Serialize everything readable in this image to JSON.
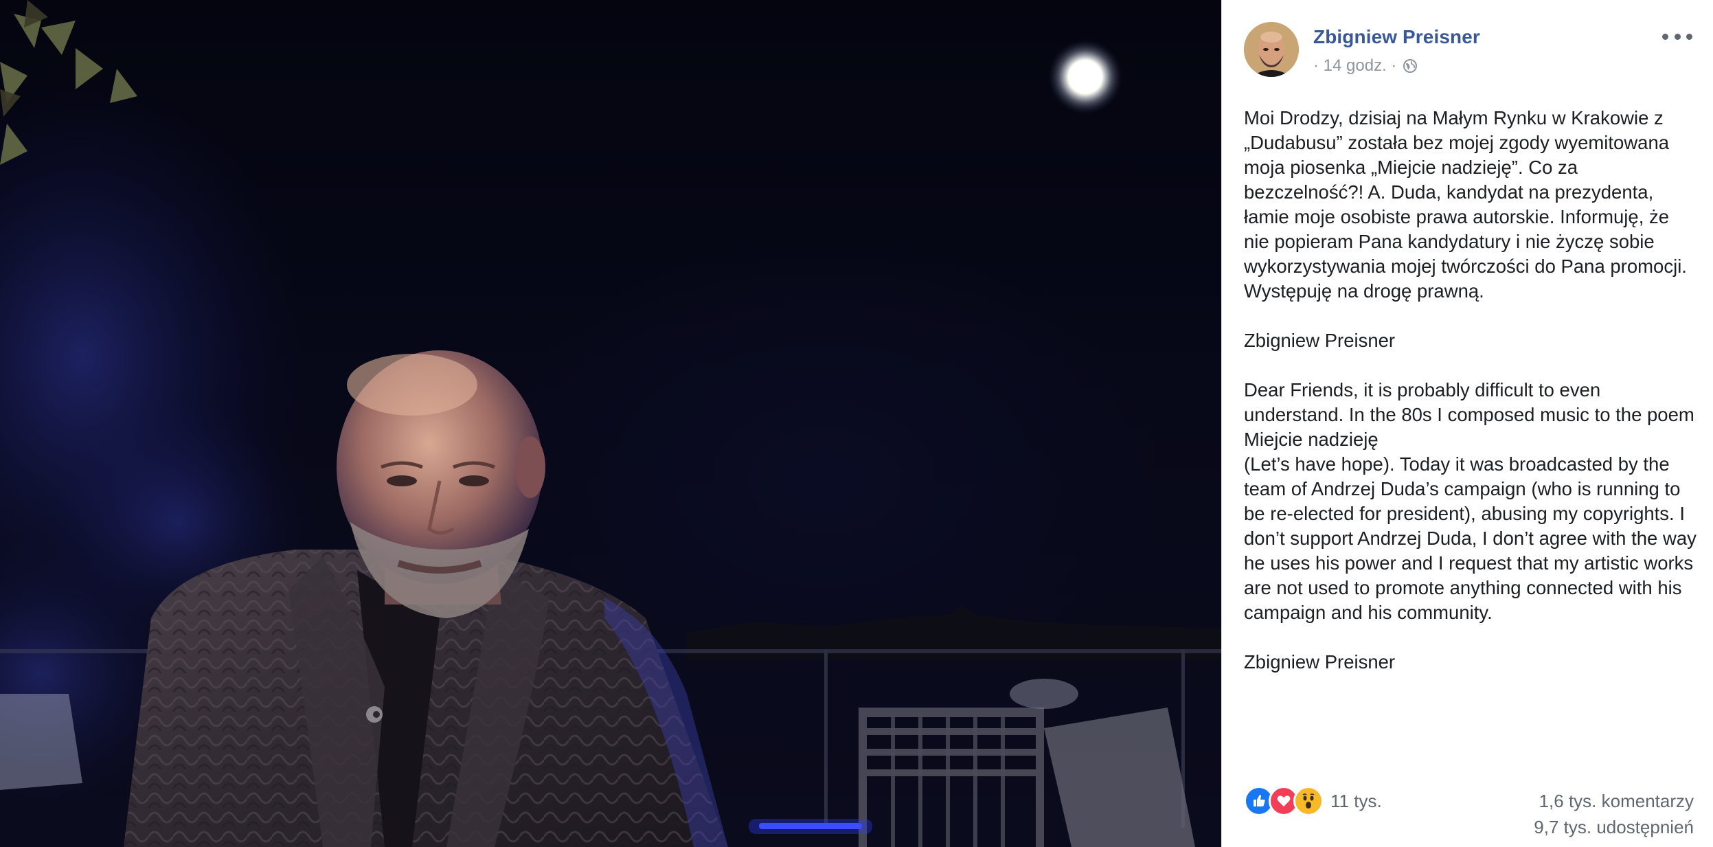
{
  "post": {
    "author": "Zbigniew Preisner",
    "timestamp": "· 14 godz. ·",
    "privacy_icon": "globe-icon",
    "more_icon": "more-options-icon",
    "paragraphs": [
      "Moi Drodzy, dzisiaj na Małym Rynku w Krakowie z „Dudabusu” została bez mojej zgody wyemitowana moja piosenka „Miejcie nadzieję”. Co za bezczelność?! A. Duda, kandydat na prezydenta, łamie moje osobiste prawa autorskie. Informuję, że nie popieram Pana kandydatury i nie życzę sobie wykorzystywania mojej twórczości do Pana promocji.\nWystępuję na drogę prawną.",
      "Zbigniew Preisner",
      "Dear Friends, it is probably difficult to even understand. In the 80s I composed music to the poem Miejcie nadzieję\n(Let’s have hope). Today it was broadcasted by the team of Andrzej Duda’s campaign (who is running to be re-elected for president), abusing my copyrights. I don’t support Andrzej Duda, I don’t agree with the way he uses his power and I request that my artistic works are not used to promote anything connected with his campaign and his community.",
      "Zbigniew Preisner"
    ]
  },
  "footer": {
    "reactions": [
      "like-icon",
      "love-icon",
      "wow-icon"
    ],
    "reaction_count": "11 tys.",
    "comments": "1,6 tys. komentarzy",
    "shares": "9,7 tys. udostępnień"
  },
  "colors": {
    "author_link": "#385898",
    "meta_grey": "#90949c",
    "text": "#1c1e21",
    "like_blue": "#1877f2",
    "love_red": "#f33e58",
    "wow_yellow": "#f7b928"
  }
}
